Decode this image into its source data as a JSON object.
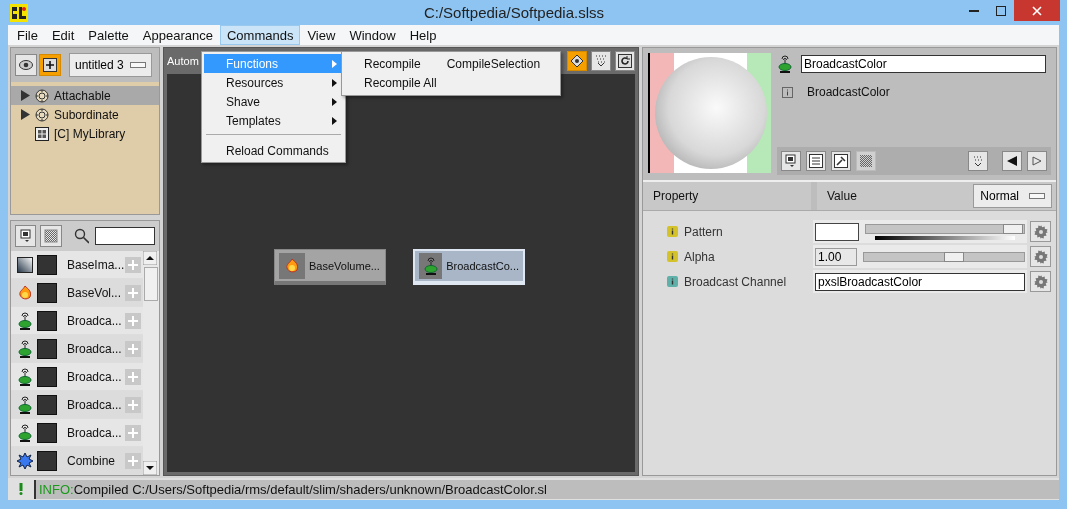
{
  "window": {
    "title": "C:/Softpedia/Softpedia.slss"
  },
  "menu_bar": [
    {
      "label": "File",
      "selected": false
    },
    {
      "label": "Edit",
      "selected": false
    },
    {
      "label": "Palette",
      "selected": false
    },
    {
      "label": "Appearance",
      "selected": false
    },
    {
      "label": "Commands",
      "selected": true
    },
    {
      "label": "View",
      "selected": false
    },
    {
      "label": "Window",
      "selected": false
    },
    {
      "label": "Help",
      "selected": false
    }
  ],
  "open_menu": {
    "items": [
      {
        "kind": "item",
        "label": "Functions",
        "submenu": true,
        "selected": true
      },
      {
        "kind": "item",
        "label": "Resources",
        "submenu": true,
        "selected": false
      },
      {
        "kind": "item",
        "label": "Shave",
        "submenu": true,
        "selected": false
      },
      {
        "kind": "item",
        "label": "Templates",
        "submenu": true,
        "selected": false
      },
      {
        "kind": "separator"
      },
      {
        "kind": "item",
        "label": "Reload Commands",
        "submenu": false,
        "selected": false
      }
    ]
  },
  "submenu": {
    "items": [
      {
        "label": "Recompile"
      },
      {
        "label": "CompileSelection"
      },
      {
        "label": "Recompile All"
      }
    ]
  },
  "left_panel": {
    "shader_dropdown": "untitled 3",
    "tree": [
      {
        "label": "Attachable",
        "kind": "category",
        "expandable": true,
        "selected": true
      },
      {
        "label": "Subordinate",
        "kind": "category",
        "expandable": true,
        "selected": false
      },
      {
        "label": "[C] MyLibrary",
        "kind": "library",
        "expandable": false,
        "selected": false
      }
    ]
  },
  "palette": {
    "items": [
      {
        "label": "BaseIma...",
        "kind": "image"
      },
      {
        "label": "BaseVol...",
        "kind": "volume"
      },
      {
        "label": "Broadca...",
        "kind": "broadcast"
      },
      {
        "label": "Broadca...",
        "kind": "broadcast"
      },
      {
        "label": "Broadca...",
        "kind": "broadcast"
      },
      {
        "label": "Broadca...",
        "kind": "broadcast"
      },
      {
        "label": "Broadca...",
        "kind": "broadcast"
      },
      {
        "label": "Combine",
        "kind": "combine"
      }
    ]
  },
  "canvas": {
    "header": "Autom",
    "nodes": [
      {
        "label": "BaseVolume...",
        "kind": "volume",
        "selected": false
      },
      {
        "label": "BroadcastCo...",
        "kind": "broadcast",
        "selected": true
      }
    ]
  },
  "inspector": {
    "name": "BroadcastColor",
    "info": "BroadcastColor",
    "columns": [
      "Property",
      "Value"
    ],
    "mode": "Normal",
    "properties": [
      {
        "kind": "color",
        "label": "Pattern",
        "color": "#d4c22a",
        "level": 0.93
      },
      {
        "kind": "slider",
        "label": "Alpha",
        "color": "#d4c22a",
        "value": "1.00",
        "level": 0.56
      },
      {
        "kind": "text",
        "label": "Broadcast Channel",
        "color": "#5fb0a8",
        "value": "pxslBroadcastColor"
      }
    ]
  },
  "status_bar": {
    "prefix": "INFO:",
    "message": "Compiled C:/Users/Softpedia/rms/default/slim/shaders/unknown/BroadcastColor.sl"
  }
}
